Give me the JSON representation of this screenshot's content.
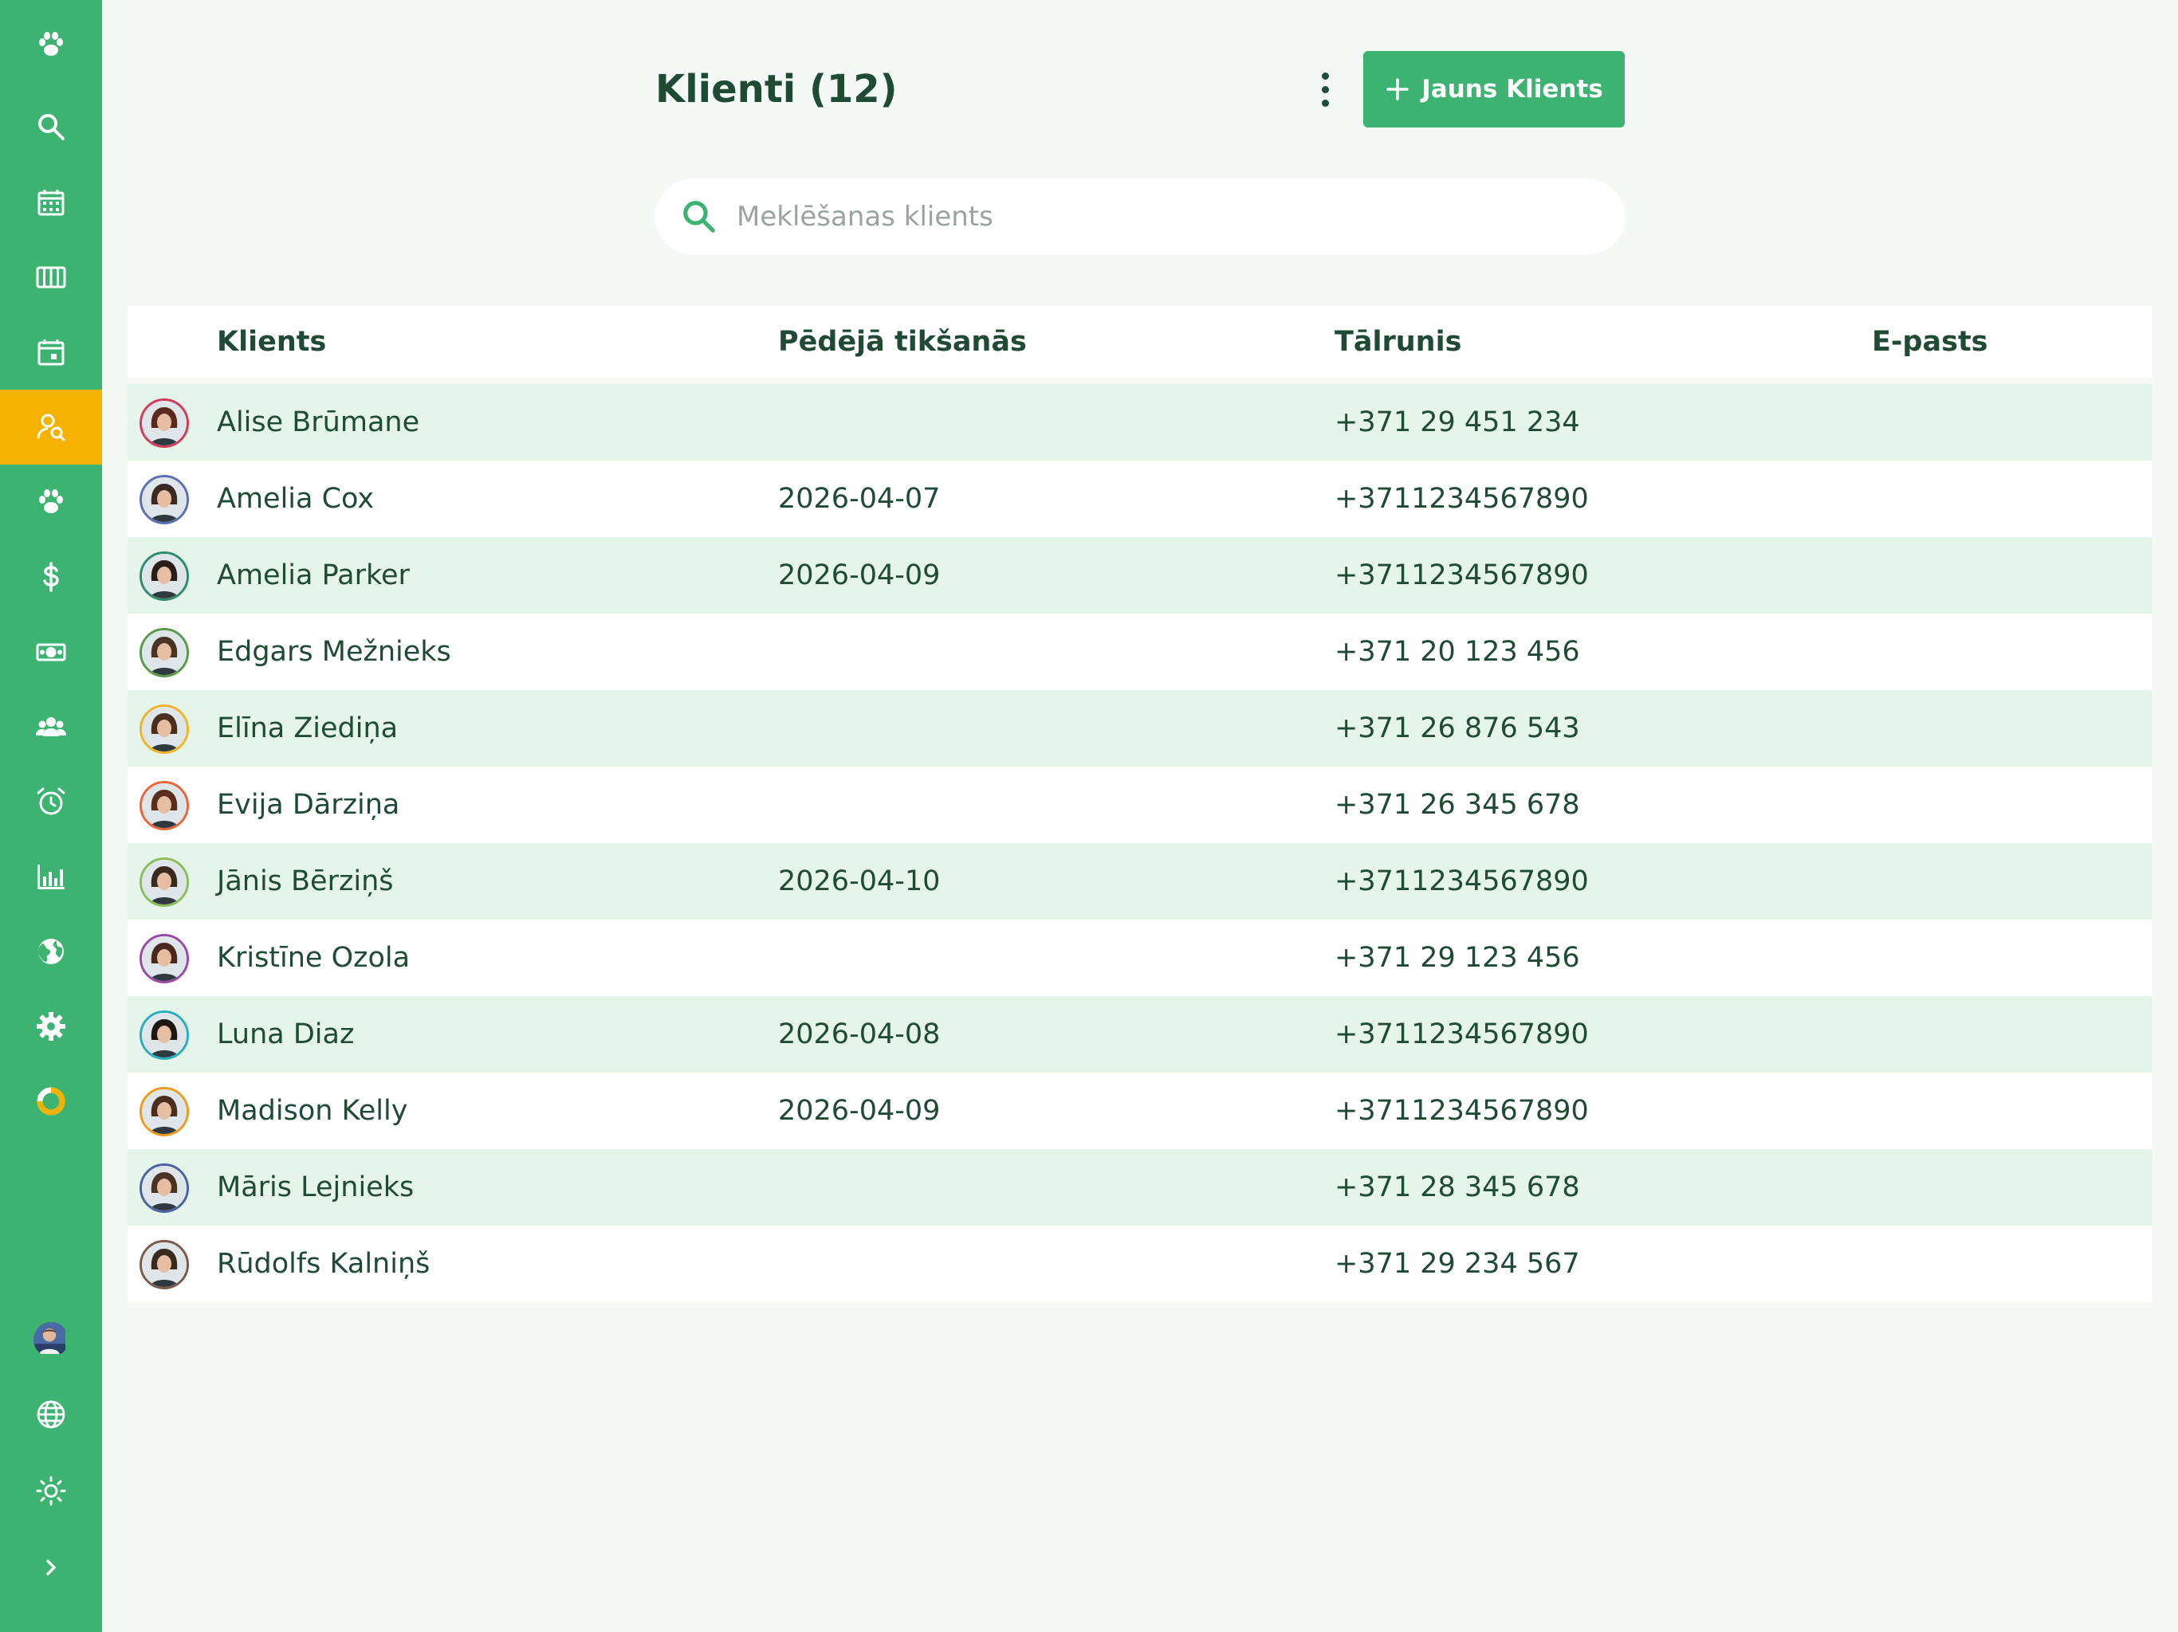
{
  "header": {
    "title": "Klienti (12)",
    "new_client_label": "Jauns Klients"
  },
  "search": {
    "placeholder": "Meklēšanas klients",
    "value": ""
  },
  "table": {
    "columns": [
      "Klients",
      "Pēdējā tikšanās",
      "Tālrunis",
      "E-pasts"
    ],
    "rows": [
      {
        "name": "Alise Brūmane",
        "last_meeting": "",
        "phone": "+371 29 451 234",
        "email": "",
        "ring": "#d23b5a",
        "hair": "#5a2a1e"
      },
      {
        "name": "Amelia Cox",
        "last_meeting": "2026-04-07",
        "phone": "+3711234567890",
        "email": "",
        "ring": "#5b6fb5",
        "hair": "#3a2a22"
      },
      {
        "name": "Amelia Parker",
        "last_meeting": "2026-04-09",
        "phone": "+3711234567890",
        "email": "",
        "ring": "#2e8b6e",
        "hair": "#2b1d16"
      },
      {
        "name": "Edgars Mežnieks",
        "last_meeting": "",
        "phone": "+371 20 123 456",
        "email": "",
        "ring": "#5a9a4a",
        "hair": "#4a3322"
      },
      {
        "name": "Elīna Ziediņa",
        "last_meeting": "",
        "phone": "+371 26 876 543",
        "email": "",
        "ring": "#f0b429",
        "hair": "#4a2e1e"
      },
      {
        "name": "Evija Dārziņa",
        "last_meeting": "",
        "phone": "+371 26 345 678",
        "email": "",
        "ring": "#e8663a",
        "hair": "#5a2e1c"
      },
      {
        "name": "Jānis Bērziņš",
        "last_meeting": "2026-04-10",
        "phone": "+3711234567890",
        "email": "",
        "ring": "#8bbd5a",
        "hair": "#3a2a1e"
      },
      {
        "name": "Kristīne Ozola",
        "last_meeting": "",
        "phone": "+371 29 123 456",
        "email": "",
        "ring": "#9a4aa5",
        "hair": "#4a2a1e"
      },
      {
        "name": "Luna Diaz",
        "last_meeting": "2026-04-08",
        "phone": "+3711234567890",
        "email": "",
        "ring": "#2aaebd",
        "hair": "#1e1612"
      },
      {
        "name": "Madison Kelly",
        "last_meeting": "2026-04-09",
        "phone": "+3711234567890",
        "email": "",
        "ring": "#f09a1e",
        "hair": "#4a2e1e"
      },
      {
        "name": "Māris Lejnieks",
        "last_meeting": "",
        "phone": "+371 28 345 678",
        "email": "",
        "ring": "#4a62a5",
        "hair": "#4a3322"
      },
      {
        "name": "Rūdolfs Kalniņš",
        "last_meeting": "",
        "phone": "+371 29 234 567",
        "email": "",
        "ring": "#7a5a4a",
        "hair": "#3a2a1e"
      }
    ]
  },
  "sidebar": {
    "items": [
      {
        "icon": "paw-icon"
      },
      {
        "icon": "search-icon"
      },
      {
        "icon": "calendar-icon"
      },
      {
        "icon": "columns-icon"
      },
      {
        "icon": "calendar-day-icon"
      },
      {
        "icon": "client-search-icon",
        "active": true
      },
      {
        "icon": "paw-icon"
      },
      {
        "icon": "dollar-icon"
      },
      {
        "icon": "cash-icon"
      },
      {
        "icon": "group-icon"
      },
      {
        "icon": "alarm-icon"
      },
      {
        "icon": "bar-chart-icon"
      },
      {
        "icon": "globe-filled-icon"
      },
      {
        "icon": "gear-icon"
      },
      {
        "icon": "progress-ring-icon"
      }
    ],
    "bottom": [
      {
        "icon": "user-avatar"
      },
      {
        "icon": "language-globe-icon"
      },
      {
        "icon": "sun-icon"
      },
      {
        "icon": "chevron-right-icon"
      }
    ]
  },
  "colors": {
    "sidebar": "#3cb371",
    "accent": "#3cb371",
    "active": "#f5b300",
    "text": "#1f4a34",
    "row_alt": "#e6f5ea",
    "background": "#f4f9f5"
  }
}
